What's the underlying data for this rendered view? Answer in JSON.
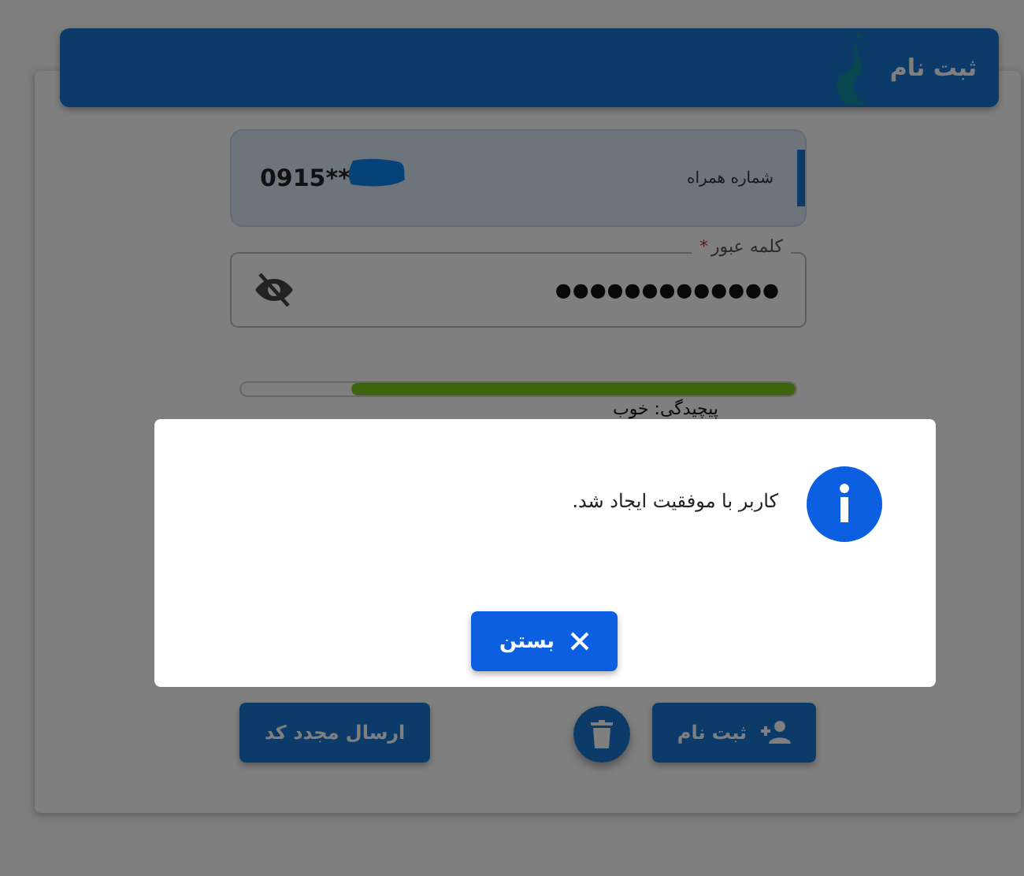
{
  "header": {
    "title": "ثبت نام"
  },
  "phone": {
    "label": "شماره همراه",
    "value": "0915**"
  },
  "password": {
    "label": "کلمه عبور",
    "required_mark": "*",
    "value": "●●●●●●●●●●●●●"
  },
  "strength": {
    "level": 0.8,
    "label": "پیچیدگی: خوب"
  },
  "actions": [
    {
      "kind": "primary",
      "label": "ثبت نام"
    },
    {
      "kind": "icon"
    },
    {
      "kind": "secondary",
      "label": "ارسال مجدد کد"
    }
  ],
  "dialog": {
    "message": "کاربر با موفقیت ایجاد شد.",
    "button": "بستن"
  }
}
